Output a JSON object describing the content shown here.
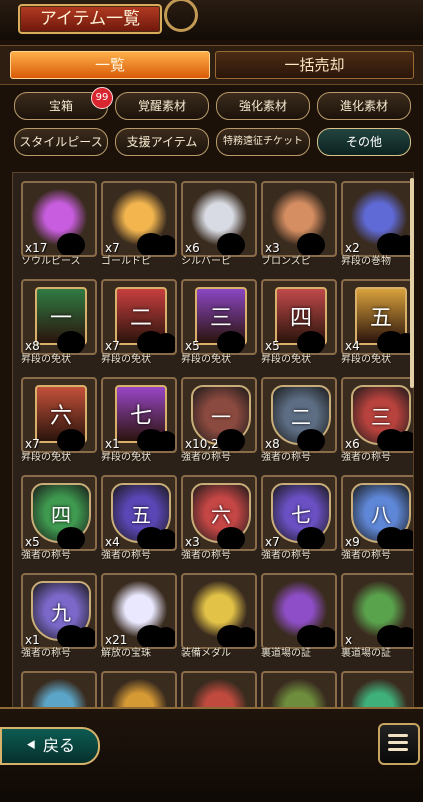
{
  "header": {
    "title": "アイテム一覧"
  },
  "tabs": [
    {
      "label": "一覧"
    },
    {
      "label": "一括売却"
    }
  ],
  "categories": {
    "row1": [
      {
        "label": "宝箱",
        "badge": "99"
      },
      {
        "label": "覚醒素材"
      },
      {
        "label": "強化素材"
      },
      {
        "label": "進化素材"
      }
    ],
    "row2": [
      {
        "label": "スタイルピース"
      },
      {
        "label": "支援アイテム"
      },
      {
        "label": "特務遠征チケット"
      },
      {
        "label": "その他"
      }
    ]
  },
  "items": [
    {
      "qty": "x17",
      "name": "ソウルピース",
      "icon": "purple-soul-icon",
      "color": "#c85ddf"
    },
    {
      "qty": "x7",
      "name": "ゴールドピ",
      "icon": "gold-piece-icon",
      "color": "#f3b64f"
    },
    {
      "qty": "x6",
      "name": "シルバーピ",
      "icon": "silver-piece-icon",
      "color": "#d8dbe3"
    },
    {
      "qty": "x3",
      "name": "ブロンズピ",
      "icon": "bronze-piece-icon",
      "color": "#d58e62"
    },
    {
      "qty": "x2",
      "name": "昇段の巻物",
      "icon": "scroll-icon",
      "color": "#5f6ad7"
    },
    {
      "qty": "x8",
      "name": "昇段の免状",
      "glyph": "一",
      "icon": "license-icon",
      "color": "#2f7b43"
    },
    {
      "qty": "x7",
      "name": "昇段の免状",
      "glyph": "二",
      "icon": "license-icon",
      "color": "#c83f3f"
    },
    {
      "qty": "x5",
      "name": "昇段の免状",
      "glyph": "三",
      "icon": "license-icon",
      "color": "#8a46c2"
    },
    {
      "qty": "x5",
      "name": "昇段の免状",
      "glyph": "四",
      "icon": "license-icon",
      "color": "#c04a4a"
    },
    {
      "qty": "x4",
      "name": "昇段の免状",
      "glyph": "五",
      "icon": "license-icon",
      "color": "#d9a13c"
    },
    {
      "qty": "x7",
      "name": "昇段の免状",
      "glyph": "六",
      "icon": "license-icon",
      "color": "#c4513a"
    },
    {
      "qty": "x1",
      "name": "昇段の免状",
      "glyph": "七",
      "icon": "license-icon",
      "color": "#9946c6"
    },
    {
      "qty": "x10,273",
      "name": "強者の称号",
      "glyph": "一",
      "icon": "emblem-icon",
      "color": "#8b4a3f"
    },
    {
      "qty": "x8",
      "name": "強者の称号",
      "glyph": "二",
      "icon": "emblem-icon",
      "color": "#5d6e84"
    },
    {
      "qty": "x6",
      "name": "強者の称号",
      "glyph": "三",
      "icon": "emblem-icon",
      "color": "#b8423d"
    },
    {
      "qty": "x5",
      "name": "強者の称号",
      "glyph": "四",
      "icon": "emblem-icon",
      "color": "#3f9a50"
    },
    {
      "qty": "x4",
      "name": "強者の称号",
      "glyph": "五",
      "icon": "emblem-icon",
      "color": "#5b46b5"
    },
    {
      "qty": "x3",
      "name": "強者の称号",
      "glyph": "六",
      "icon": "emblem-icon",
      "color": "#c44645"
    },
    {
      "qty": "x7",
      "name": "強者の称号",
      "glyph": "七",
      "icon": "emblem-icon",
      "color": "#6a50c3"
    },
    {
      "qty": "x9",
      "name": "強者の称号",
      "glyph": "八",
      "icon": "emblem-icon",
      "color": "#5f87d7"
    },
    {
      "qty": "x1",
      "name": "強者の称号",
      "glyph": "九",
      "icon": "emblem-icon",
      "color": "#7b68c9"
    },
    {
      "qty": "x21",
      "name": "解放の宝珠",
      "icon": "orb-icon",
      "color": "#e9e8ff"
    },
    {
      "qty": "",
      "name": "装備メダル",
      "icon": "medal-icon",
      "color": "#e3c347"
    },
    {
      "qty": "",
      "name": "裏道場の証",
      "icon": "purple-gem-icon",
      "color": "#8e4ec7"
    },
    {
      "qty": "x",
      "name": "裏道場の証",
      "icon": "green-gem-icon",
      "color": "#5aa34d"
    },
    {
      "qty": "",
      "name": "",
      "icon": "gem-icon",
      "color": "#5ba6c8"
    },
    {
      "qty": "",
      "name": "",
      "icon": "gem-icon",
      "color": "#d69a34"
    },
    {
      "qty": "",
      "name": "",
      "icon": "gem-icon",
      "color": "#c04a3e"
    },
    {
      "qty": "",
      "name": "",
      "icon": "gem-icon",
      "color": "#6e8e3d"
    },
    {
      "qty": "",
      "name": "",
      "icon": "gem-icon",
      "color": "#3fb07a"
    }
  ],
  "footer": {
    "back": "戻る"
  }
}
